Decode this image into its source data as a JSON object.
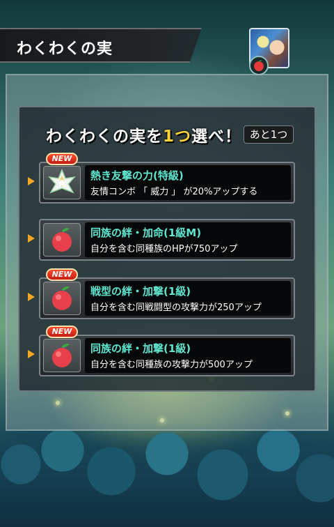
{
  "header": {
    "title": "わくわくの実",
    "character_icon": "character-portrait-icon",
    "fruit_badge_icon": "red-fruit-icon"
  },
  "selection": {
    "heading_pre": "わくわくの実を",
    "heading_highlight": "1つ",
    "heading_post": "選べ！",
    "remaining": "あと1つ"
  },
  "badges": {
    "new": "NEW"
  },
  "options": [
    {
      "title": "熱き友撃の力(特級)",
      "description": "友情コンボ 「 威力 」 が20%アップする",
      "icon": "white-crystal-fruit-icon",
      "is_new": true
    },
    {
      "title": "同族の絆・加命(1級M)",
      "description": "自分を含む同種族のHPが750アップ",
      "icon": "red-fruit-icon",
      "is_new": false
    },
    {
      "title": "戦型の絆・加撃(1級)",
      "description": "自分を含む同戦闘型の攻撃力が250アップ",
      "icon": "red-fruit-icon",
      "is_new": true
    },
    {
      "title": "同族の絆・加撃(1級)",
      "description": "自分を含む同種族の攻撃力が500アップ",
      "icon": "red-fruit-icon",
      "is_new": true
    }
  ],
  "colors": {
    "option_title": "#5ee6cf",
    "highlight": "#ffd23a",
    "arrow": "#f5a623",
    "new_badge": "#d8241a"
  }
}
